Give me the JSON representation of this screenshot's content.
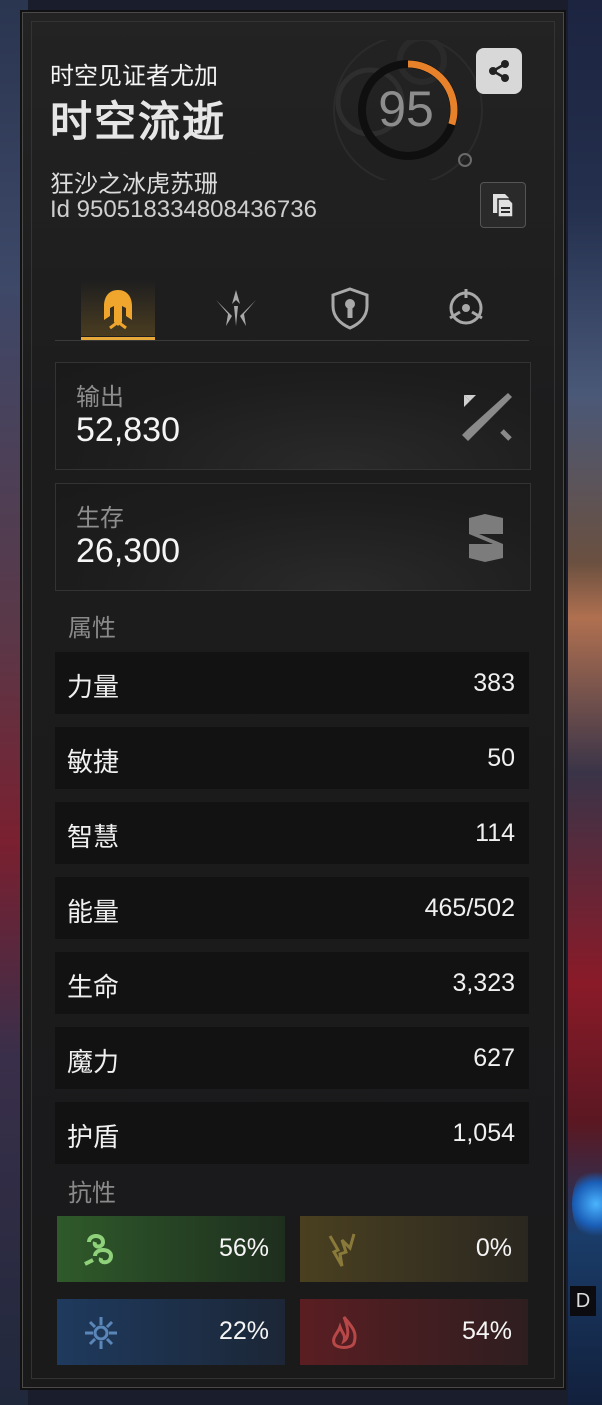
{
  "header": {
    "title": "时空见证者尤加",
    "name": "时空流逝",
    "subtitle": "狂沙之冰虎苏珊",
    "id_text": "Id 9505183348084367​36",
    "score": "95",
    "score_fraction": 0.3,
    "score_accent": "#e8822a"
  },
  "tabs": [
    {
      "name": "attack",
      "active": true,
      "icon": "helmet-icon"
    },
    {
      "name": "skills",
      "active": false,
      "icon": "claws-icon"
    },
    {
      "name": "defense",
      "active": false,
      "icon": "shield-icon"
    },
    {
      "name": "target",
      "active": false,
      "icon": "crosshair-icon"
    }
  ],
  "cards": {
    "output": {
      "label": "输出",
      "value": "52,830",
      "icon": "crossed-swords-icon"
    },
    "survival": {
      "label": "生存",
      "value": "26,300",
      "icon": "armor-icon"
    }
  },
  "attributes": {
    "label": "属性",
    "rows": [
      {
        "name": "力量",
        "value": "383"
      },
      {
        "name": "敏捷",
        "value": "50"
      },
      {
        "name": "智慧",
        "value": "114"
      },
      {
        "name": "能量",
        "value": "465/502"
      },
      {
        "name": "生命",
        "value": "3,323"
      },
      {
        "name": "魔力",
        "value": "627"
      },
      {
        "name": "护盾",
        "value": "1,054"
      }
    ]
  },
  "resistances": {
    "label": "抗性",
    "items": [
      {
        "icon": "wind-icon",
        "value": "56%",
        "color": "#2f5a2a"
      },
      {
        "icon": "lightning-icon",
        "value": "0%",
        "color": "#4a4020"
      },
      {
        "icon": "frost-icon",
        "value": "22%",
        "color": "#1e3a5e"
      },
      {
        "icon": "fire-icon",
        "value": "54%",
        "color": "#5a1e22"
      }
    ]
  },
  "background": {
    "tag": "D"
  }
}
